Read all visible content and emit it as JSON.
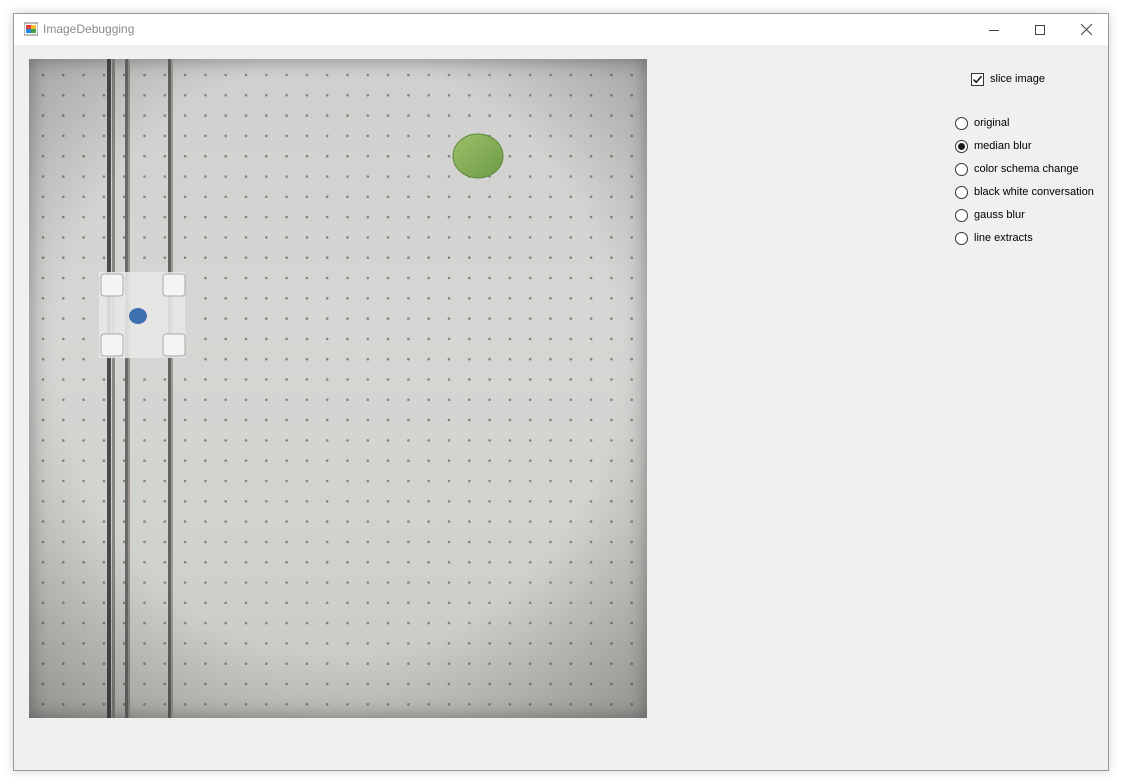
{
  "window": {
    "title": "ImageDebugging"
  },
  "options": {
    "slice_image": {
      "label": "slice image",
      "checked": true
    },
    "modes": [
      {
        "label": "original",
        "selected": false
      },
      {
        "label": "median blur",
        "selected": true
      },
      {
        "label": "color schema change",
        "selected": false
      },
      {
        "label": "black white conversation",
        "selected": false
      },
      {
        "label": "gauss blur",
        "selected": false
      },
      {
        "label": "line extracts",
        "selected": false
      }
    ]
  },
  "image": {
    "description_icon": "camera-image",
    "colors": {
      "board": "#d2d2cf",
      "dot": "#6b6b62",
      "green_marker": "#8ab05a",
      "blue_marker": "#3f6fb0",
      "rod": "#5a5a5a"
    }
  }
}
